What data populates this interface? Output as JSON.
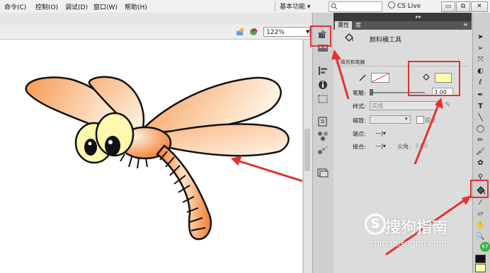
{
  "menu": [
    "命令(C)",
    "控制(O)",
    "调试(D)",
    "窗口(W)",
    "帮助(H)"
  ],
  "workspace": "基本功能",
  "workspace_arrow": "▾",
  "cs_live": "CS Live",
  "window_buttons": [
    "▭",
    "⧉",
    "✕"
  ],
  "zoom_level": "122%",
  "panel_tabs": [
    "属性",
    "库"
  ],
  "tool_title": "颜料桶工具",
  "section": "填充和笔触",
  "stroke_label": "笔触:",
  "stroke_value": "3.00",
  "style_label": "样式:",
  "style_value": "实线",
  "scale_label": "缩放:",
  "hint_label": "提示",
  "cap_label": "端点:",
  "join_label": "接合:",
  "miter_label": "尖角:",
  "miter_value": "3.00",
  "watermark_text": "搜狗指南",
  "watermark_url": "zhinan.sogou.com",
  "watermark_logo": "S",
  "badge": "67",
  "colors": {
    "fill_swatch": "#ffffa8",
    "highlight": "#e53030",
    "wing": "#f7a864",
    "body": "#f58a3e"
  }
}
